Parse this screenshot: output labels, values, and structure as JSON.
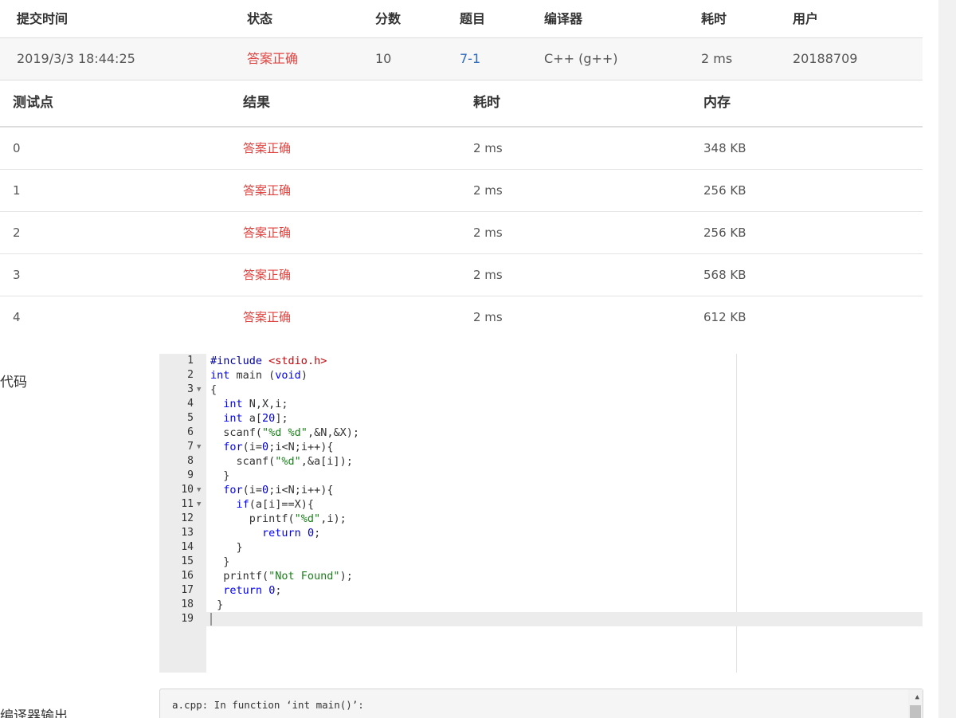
{
  "submission": {
    "headers": [
      "提交时间",
      "状态",
      "分数",
      "题目",
      "编译器",
      "耗时",
      "用户"
    ],
    "row": {
      "time": "2019/3/3 18:44:25",
      "status": "答案正确",
      "score": "10",
      "problem": "7-1",
      "compiler": "C++ (g++)",
      "duration": "2 ms",
      "user": "20188709"
    }
  },
  "tests": {
    "headers": [
      "测试点",
      "结果",
      "耗时",
      "内存"
    ],
    "rows": [
      {
        "id": "0",
        "result": "答案正确",
        "time": "2 ms",
        "memory": "348 KB"
      },
      {
        "id": "1",
        "result": "答案正确",
        "time": "2 ms",
        "memory": "256 KB"
      },
      {
        "id": "2",
        "result": "答案正确",
        "time": "2 ms",
        "memory": "256 KB"
      },
      {
        "id": "3",
        "result": "答案正确",
        "time": "2 ms",
        "memory": "568 KB"
      },
      {
        "id": "4",
        "result": "答案正确",
        "time": "2 ms",
        "memory": "612 KB"
      }
    ]
  },
  "code_section": {
    "label": "代码",
    "lines": [
      "#include <stdio.h>",
      "int main (void)",
      "{",
      "  int N,X,i;",
      "  int a[20];",
      "  scanf(\"%d %d\",&N,&X);",
      "  for(i=0;i<N;i++){",
      "    scanf(\"%d\",&a[i]);",
      "  }",
      "  for(i=0;i<N;i++){",
      "    if(a[i]==X){",
      "      printf(\"%d\",i);",
      "        return 0;",
      "    }",
      "  }",
      "  printf(\"Not Found\");",
      "  return 0;",
      " }",
      ""
    ],
    "fold_lines": [
      3,
      7,
      10,
      11
    ],
    "active_line": 19
  },
  "compiler_output": {
    "label": "编译器输出",
    "text": "a.cpp: In function ‘int main()’:"
  }
}
